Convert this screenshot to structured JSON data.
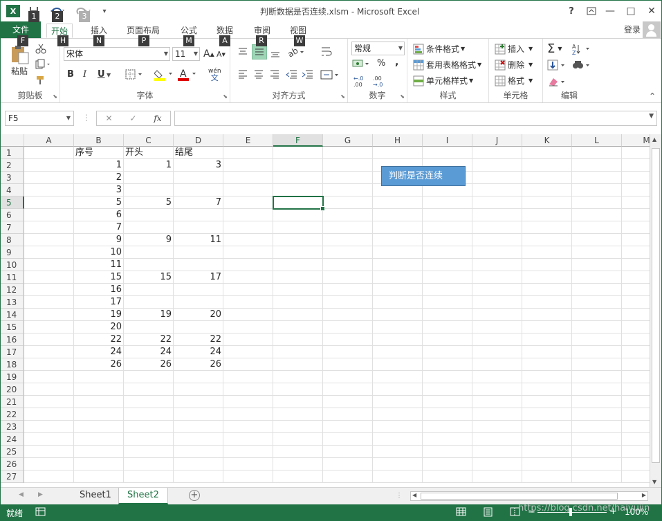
{
  "window": {
    "title": "判断数据是否连续.xlsm - Microsoft Excel",
    "app_icon": "X",
    "help": "?",
    "controls": [
      "—",
      "□",
      "✕"
    ]
  },
  "keytips": {
    "qat": [
      "1",
      "2",
      "3"
    ],
    "tabs": [
      "F",
      "H",
      "N",
      "P",
      "M",
      "A",
      "R",
      "W"
    ]
  },
  "tabs": [
    "文件",
    "开始",
    "插入",
    "页面布局",
    "公式",
    "数据",
    "审阅",
    "视图"
  ],
  "login_label": "登录",
  "ribbon": {
    "clipboard": {
      "paste_label": "粘贴",
      "group_label": "剪贴板"
    },
    "font": {
      "font_name": "宋体",
      "font_size": "11",
      "bold": "B",
      "italic": "I",
      "underline": "U",
      "wen": "wén",
      "group_label": "字体",
      "grow": "A",
      "shrink": "A"
    },
    "alignment": {
      "group_label": "对齐方式"
    },
    "number": {
      "format": "常规",
      "percent": "%",
      "comma": ",",
      "group_label": "数字"
    },
    "styles": {
      "items": [
        "条件格式",
        "套用表格格式",
        "单元格样式"
      ],
      "group_label": "样式"
    },
    "cells": {
      "items": [
        "插入",
        "删除",
        "格式"
      ],
      "group_label": "单元格"
    },
    "editing": {
      "sigma": "Σ",
      "group_label": "编辑"
    }
  },
  "formula_bar": {
    "name_box": "F5",
    "fx": "fx",
    "cancel": "✕",
    "enter": "✓",
    "value": ""
  },
  "columns": [
    "A",
    "B",
    "C",
    "D",
    "E",
    "F",
    "G",
    "H",
    "I",
    "J",
    "K",
    "L",
    "M"
  ],
  "rows": [
    "1",
    "2",
    "3",
    "4",
    "5",
    "6",
    "7",
    "8",
    "9",
    "10",
    "11",
    "12",
    "13",
    "14",
    "15",
    "16",
    "17",
    "18",
    "19",
    "20",
    "21",
    "22",
    "23",
    "24",
    "25",
    "26",
    "27"
  ],
  "cells": {
    "header": [
      "序号",
      "开头",
      "结尾"
    ],
    "B": [
      "",
      "1",
      "2",
      "3",
      "5",
      "6",
      "7",
      "9",
      "10",
      "11",
      "15",
      "16",
      "17",
      "19",
      "20",
      "22",
      "24",
      "26"
    ],
    "C": [
      "",
      "1",
      "",
      "",
      "5",
      "",
      "",
      "9",
      "",
      "",
      "15",
      "",
      "",
      "19",
      "",
      "22",
      "24",
      "26"
    ],
    "D": [
      "",
      "3",
      "",
      "",
      "7",
      "",
      "",
      "11",
      "",
      "",
      "17",
      "",
      "",
      "20",
      "",
      "22",
      "24",
      "26"
    ]
  },
  "shape_button": "判断是否连续",
  "sheets": [
    "Sheet1",
    "Sheet2"
  ],
  "active_sheet": "Sheet2",
  "status": {
    "ready": "就绪",
    "zoom": "100%",
    "watermark": "https://blog.csdn.net/haiyujin"
  },
  "colors": {
    "accent": "#217346",
    "shape": "#5b9bd5"
  }
}
